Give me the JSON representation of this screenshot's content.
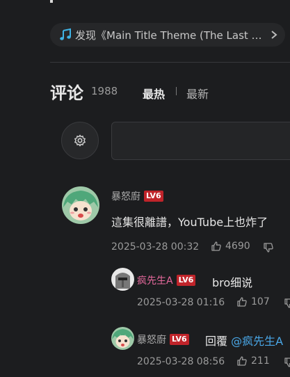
{
  "music": {
    "prefix": "发现",
    "title": "《Main Title Theme (The Last E..."
  },
  "comments_header": {
    "title": "评论",
    "count": "1988",
    "sort_hot": "最热",
    "sort_new": "最新"
  },
  "comments": [
    {
      "user": "暴怒廚",
      "level": "LV6",
      "text": "這集很離譜，YouTube上也炸了",
      "time": "2025-03-28 00:32",
      "likes": "4690"
    }
  ],
  "replies": [
    {
      "user": "疯先生A",
      "level": "LV6",
      "text": "bro细说",
      "time": "2025-03-28 01:16",
      "likes": "107"
    },
    {
      "user": "暴怒廚",
      "level": "LV6",
      "reply_prefix": "回覆",
      "mention": "@疯先生A",
      "time": "2025-03-28 08:56",
      "likes": "211"
    }
  ],
  "colors": {
    "background": "#1c1d1f",
    "level_badge": "#c0242a",
    "mention": "#4aa8e8",
    "pink_name": "#e86a9e"
  }
}
